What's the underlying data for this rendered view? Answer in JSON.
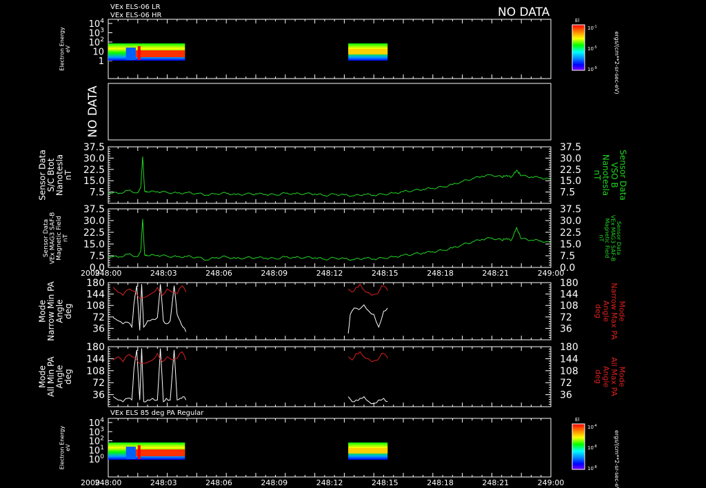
{
  "header": {
    "line1": "VEx ELS-06 LR",
    "line2": "VEx ELS-06 HR",
    "no_data_top": "NO DATA"
  },
  "time_axis": {
    "year": "2009",
    "ticks": [
      "248:00",
      "248:03",
      "248:06",
      "248:09",
      "248:12",
      "248:15",
      "248:18",
      "248:21",
      "249:00"
    ]
  },
  "colors": {
    "background": "#000000",
    "axes": "#ffffff",
    "field": "#22d622",
    "min_angle": "#ffffff",
    "max_angle": "#dd2020"
  },
  "chart_data": [
    {
      "id": "els_spectrogram_top",
      "type": "heatmap",
      "ylabel_lines": [
        "Electron Energy",
        "eV"
      ],
      "ytick_labels": [
        "10^4",
        "10^3",
        "10^2",
        "10",
        "1"
      ],
      "y_scale": "log",
      "colorbar": {
        "title": "El",
        "unit": "ergs/(cm**2-sr-sec-eV)",
        "tick_labels": [
          "10^-1",
          "10^-5",
          "10^-9"
        ],
        "colors": [
          "#ff0000",
          "#ff8000",
          "#ffff00",
          "#00ff00",
          "#00ffff",
          "#0080ff",
          "#0000ff",
          "#8000ff"
        ]
      },
      "data_intervals_minutes": [
        [
          0,
          7.8
        ],
        [
          24.4,
          28.4
        ]
      ],
      "note_visible": "NO DATA"
    },
    {
      "id": "no_data_panel",
      "type": "table",
      "label": "NO DATA"
    },
    {
      "id": "bmag_sc",
      "type": "line",
      "ylabel_lines": [
        "Sensor Data",
        "S/C Btot",
        "Nanotesla",
        "nT"
      ],
      "right_label_lines": [
        "Sensor Data",
        "VSO B",
        "Nanotesla",
        "nT"
      ],
      "ytick_labels": [
        "37.5",
        "30.0",
        "22.5",
        "15.0",
        "7.5"
      ],
      "ylim": [
        0,
        37.5
      ],
      "series": [
        {
          "x": [
            0,
            1,
            2,
            3,
            3.3,
            3.5,
            3.7,
            4,
            5,
            6,
            7,
            8,
            9,
            10,
            11,
            12,
            13,
            14,
            15,
            16,
            17,
            18,
            19,
            20,
            21,
            22,
            23,
            24,
            25,
            26,
            27,
            28,
            29,
            30,
            31,
            32,
            33,
            34,
            35,
            36,
            37,
            38,
            39,
            40,
            40.5,
            41,
            41.5,
            42,
            43,
            44,
            45
          ],
          "y": [
            7.5,
            6.5,
            8.5,
            7.0,
            10.5,
            31.0,
            8.0,
            7.5,
            7.8,
            7.2,
            6.8,
            7.0,
            6.6,
            5.5,
            6.3,
            6.8,
            5.7,
            6.2,
            6.3,
            6.0,
            5.6,
            6.7,
            6.3,
            6.4,
            6.2,
            5.2,
            6.1,
            5.6,
            5.0,
            6.0,
            5.4,
            6.0,
            6.7,
            7.8,
            8.5,
            9.3,
            10.0,
            10.9,
            12.5,
            14.5,
            16.3,
            18.0,
            18.8,
            17.5,
            18.6,
            17.5,
            22.0,
            18.3,
            17.5,
            17.0,
            15.6
          ]
        }
      ]
    },
    {
      "id": "bmag_mag3",
      "type": "line",
      "ylabel_lines": [
        "Sensor Data",
        "VEx MAG3 SAF-B",
        "Magnetic Field",
        "nT"
      ],
      "right_label_lines": [
        "Sensor Data",
        "VEx MAG3 SAF-B",
        "Magnetic Field",
        "nT"
      ],
      "ytick_labels": [
        "37.5",
        "30.0",
        "22.5",
        "15.0",
        "7.5",
        "0.0"
      ],
      "ylim": [
        0,
        37.5
      ],
      "series": [
        {
          "x": [
            0,
            1,
            2,
            3,
            3.3,
            3.5,
            3.7,
            4,
            5,
            6,
            7,
            8,
            9,
            10,
            11,
            12,
            13,
            14,
            15,
            16,
            17,
            18,
            19,
            20,
            21,
            22,
            23,
            24,
            25,
            26,
            27,
            28,
            29,
            30,
            31,
            32,
            33,
            34,
            35,
            36,
            37,
            38,
            39,
            40,
            40.5,
            41,
            41.5,
            42,
            43,
            44,
            45
          ],
          "y": [
            7.5,
            6.5,
            8.5,
            7.0,
            10.5,
            31.0,
            8.0,
            7.5,
            7.8,
            7.2,
            6.8,
            7.0,
            6.6,
            4.8,
            6.3,
            6.8,
            5.7,
            6.2,
            6.3,
            6.0,
            5.6,
            6.7,
            6.3,
            6.4,
            6.2,
            5.2,
            6.1,
            5.6,
            5.0,
            6.0,
            5.4,
            6.0,
            6.7,
            7.8,
            8.5,
            9.3,
            10.0,
            10.9,
            12.5,
            14.5,
            16.3,
            18.0,
            18.8,
            17.5,
            18.6,
            17.5,
            25.5,
            18.3,
            17.5,
            17.0,
            15.6
          ]
        }
      ]
    },
    {
      "id": "narrow_pa",
      "type": "line",
      "ylabel_lines": [
        "Mode",
        "Narrow Min PA",
        "Angle",
        "deg"
      ],
      "right_label_lines": [
        "Mode",
        "Narrow Max PA",
        "Angle",
        "deg"
      ],
      "ytick_labels": [
        "180",
        "144",
        "108",
        "72",
        "36"
      ],
      "ylim": [
        0,
        180
      ],
      "series": [
        {
          "name": "min",
          "segments": [
            {
              "x": [
                0.5,
                1,
                1.5,
                2,
                2.4,
                2.6,
                2.9,
                3.2,
                3.4,
                3.6,
                4.0,
                4.5,
                5.0,
                5.3,
                5.6,
                5.9,
                6.3,
                6.7,
                7.0,
                7.3,
                7.6,
                7.9
              ],
              "y": [
                70,
                60,
                50,
                55,
                40,
                110,
                170,
                30,
                175,
                40,
                60,
                65,
                70,
                175,
                60,
                50,
                60,
                170,
                80,
                60,
                40,
                25
              ]
            },
            {
              "x": [
                24.4,
                24.6,
                25,
                25.5,
                26,
                26.5,
                27,
                27.5,
                28,
                28.4
              ],
              "y": [
                20,
                80,
                100,
                95,
                110,
                90,
                80,
                40,
                90,
                100
              ]
            }
          ]
        },
        {
          "name": "max",
          "segments": [
            {
              "x": [
                0.5,
                1,
                1.5,
                2,
                2.4,
                2.8,
                3.2,
                4.5,
                5,
                5.5,
                6,
                6.5,
                7,
                7.5,
                7.9
              ],
              "y": [
                165,
                150,
                140,
                158,
                155,
                150,
                130,
                148,
                165,
                140,
                160,
                150,
                145,
                170,
                150
              ]
            },
            {
              "x": [
                24.4,
                24.8,
                25.2,
                25.6,
                26.2,
                26.8,
                27.4,
                27.8,
                28.2,
                28.4
              ],
              "y": [
                160,
                150,
                165,
                175,
                150,
                140,
                145,
                170,
                165,
                155
              ]
            }
          ]
        }
      ]
    },
    {
      "id": "all_pa",
      "type": "line",
      "ylabel_lines": [
        "Mode",
        "All Min PA",
        "Angle",
        "deg"
      ],
      "right_label_lines": [
        "Mode",
        "All Max PA",
        "Angle",
        "deg"
      ],
      "ytick_labels": [
        "180",
        "144",
        "108",
        "72",
        "36"
      ],
      "ylim": [
        0,
        180
      ],
      "series": [
        {
          "name": "min",
          "segments": [
            {
              "x": [
                0.5,
                1,
                1.5,
                2,
                2.4,
                2.6,
                2.9,
                3.2,
                3.4,
                3.6,
                4.0,
                4.5,
                5.0,
                5.3,
                5.6,
                5.9,
                6.3,
                6.7,
                7.0,
                7.3,
                7.6,
                7.9
              ],
              "y": [
                30,
                20,
                15,
                25,
                20,
                110,
                170,
                20,
                175,
                15,
                20,
                25,
                20,
                175,
                15,
                25,
                20,
                170,
                20,
                25,
                30,
                20
              ]
            },
            {
              "x": [
                24.4,
                24.8,
                25.2,
                25.6,
                26,
                26.5,
                27,
                27.5,
                28,
                28.4
              ],
              "y": [
                30,
                15,
                20,
                25,
                30,
                15,
                10,
                20,
                25,
                15
              ]
            }
          ]
        },
        {
          "name": "max",
          "segments": [
            {
              "x": [
                0.5,
                1,
                1.5,
                2,
                2.4,
                2.8,
                3.2,
                4.5,
                5,
                5.5,
                6,
                6.5,
                7,
                7.5,
                7.9
              ],
              "y": [
                140,
                150,
                135,
                155,
                150,
                145,
                130,
                140,
                160,
                135,
                150,
                140,
                145,
                165,
                140
              ]
            },
            {
              "x": [
                24.4,
                24.8,
                25.2,
                25.6,
                26.2,
                26.8,
                27.4,
                27.8,
                28.2,
                28.4
              ],
              "y": [
                150,
                140,
                160,
                165,
                145,
                135,
                140,
                160,
                155,
                145
              ]
            }
          ]
        }
      ]
    },
    {
      "id": "els_spectrogram_bottom",
      "type": "heatmap",
      "title": "VEx ELS 85 deg PA Regular",
      "ylabel_lines": [
        "Electron Energy",
        "eV"
      ],
      "ytick_labels": [
        "10^4",
        "10^3",
        "10^2",
        "10^1",
        "10^0"
      ],
      "y_scale": "log",
      "colorbar": {
        "title": "El",
        "unit": "ergs/(cm**2-sr-sec-eV)",
        "tick_labels": [
          "10^-4",
          "10^-8",
          "10^-8"
        ],
        "colors": [
          "#ff0000",
          "#ff8000",
          "#ffff00",
          "#00ff00",
          "#00ffff",
          "#0080ff",
          "#0000ff",
          "#8000ff"
        ]
      },
      "data_intervals_minutes": [
        [
          0,
          7.8
        ],
        [
          24.4,
          28.4
        ]
      ]
    }
  ]
}
